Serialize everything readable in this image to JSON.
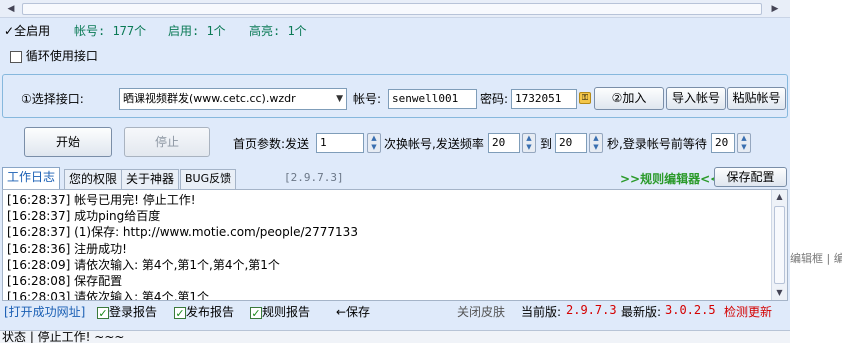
{
  "stats": {
    "enable_all": "全启用",
    "accounts": "帐号: 177个",
    "enabled": "启用: 1个",
    "highlighted": "高亮: 1个"
  },
  "loop_checkbox": {
    "label": "循环使用接口",
    "checked": false
  },
  "interface": {
    "select_label": "①选择接口:",
    "select_value": "晒课视频群发(www.cetc.cc).wzdr",
    "account_label": "帐号:",
    "account_value": "senwell001",
    "password_label": "密码:",
    "password_value": "1732051",
    "add_button": "②加入",
    "import_button": "导入帐号",
    "paste_button": "粘贴帐号"
  },
  "controls": {
    "start_button": "开始",
    "stop_button": "停止",
    "params_label": "首页参数:发送",
    "send_value": "1",
    "switch_label": "次换帐号,发送频率",
    "freq_from": "20",
    "to_label": "到",
    "freq_to": "20",
    "wait_label": "秒,登录帐号前等待",
    "wait_value": "20"
  },
  "tabs": [
    {
      "label": "工作日志",
      "active": true
    },
    {
      "label": "您的权限",
      "active": false
    },
    {
      "label": "关于神器",
      "active": false
    },
    {
      "label": "BUG反馈",
      "active": false
    }
  ],
  "version_center": "[2.9.7.3]",
  "rule_editor_link": ">>规则编辑器<<",
  "save_config_button": "保存配置",
  "log_lines": [
    "[16:28:37] 帐号已用完! 停止工作!",
    "[16:28:37] 成功ping给百度",
    "[16:28:37] (1)保存: http://www.motie.com/people/2777133",
    "[16:28:36] 注册成功!",
    "[16:28:09] 请依次输入: 第4个,第1个,第4个,第1个",
    "[16:28:08] 保存配置",
    "[16:28:03] 请依次输入: 第4个,第1个"
  ],
  "bottom": {
    "open_success": "[打开成功网址]",
    "login_report": {
      "label": "登录报告",
      "checked": true
    },
    "publish_report": {
      "label": "发布报告",
      "checked": true
    },
    "rule_report": {
      "label": "规则报告",
      "checked": true
    },
    "save_link": "←保存",
    "close_skin": "关闭皮肤",
    "current_label": "当前版:",
    "current_version": "2.9.7.3",
    "latest_label": "最新版:",
    "latest_version": "3.0.2.5",
    "check_update": "检测更新"
  },
  "status_bar": "状态 | 停止工作! ~~~",
  "background_text": "编辑框 | 编",
  "colors": {
    "accent_green": "#0a7a55",
    "link_blue": "#1a5fb4",
    "version_red": "#d40000",
    "panel_bg": "#dfeafa"
  }
}
